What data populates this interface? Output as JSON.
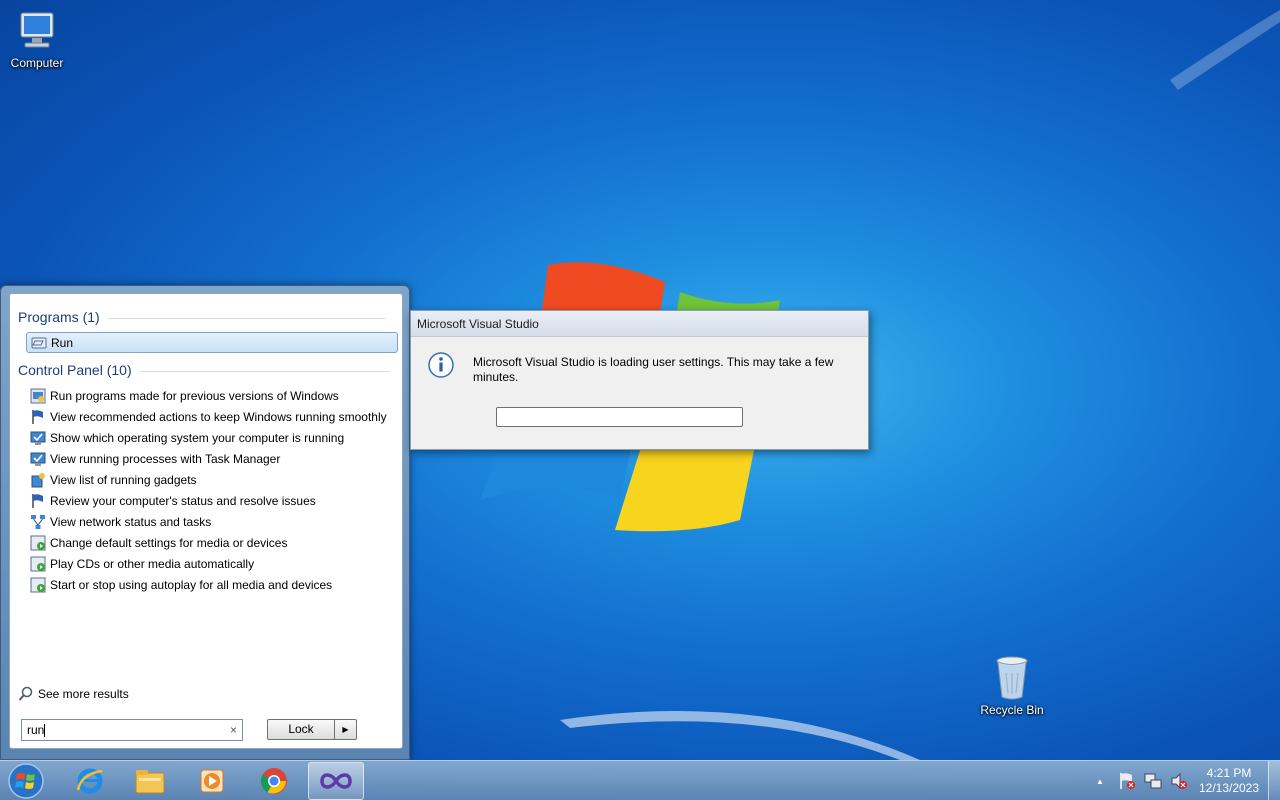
{
  "desktop": {
    "icons": [
      {
        "label": "Computer"
      },
      {
        "label": "Recycle Bin"
      }
    ]
  },
  "start_menu": {
    "programs_heading": "Programs (1)",
    "programs": [
      {
        "label": "Run",
        "icon": "run-icon"
      }
    ],
    "control_panel_heading": "Control Panel (10)",
    "control_panel": [
      {
        "label": "Run programs made for previous versions of Windows",
        "icon": "compat-icon"
      },
      {
        "label": "View recommended actions to keep Windows running smoothly",
        "icon": "flag-icon"
      },
      {
        "label": "Show which operating system your computer is running",
        "icon": "system-icon"
      },
      {
        "label": "View running processes with Task Manager",
        "icon": "system-icon"
      },
      {
        "label": "View list of running gadgets",
        "icon": "gadget-icon"
      },
      {
        "label": "Review your computer's status and resolve issues",
        "icon": "flag-icon"
      },
      {
        "label": "View network status and tasks",
        "icon": "network-icon"
      },
      {
        "label": "Change default settings for media or devices",
        "icon": "autoplay-icon"
      },
      {
        "label": "Play CDs or other media automatically",
        "icon": "autoplay-icon"
      },
      {
        "label": "Start or stop using autoplay for all media and devices",
        "icon": "autoplay-icon"
      }
    ],
    "see_more": "See more results",
    "search_value": "run",
    "search_clear": "×",
    "lock_label": "Lock",
    "lock_arrow": "▶"
  },
  "dialog": {
    "title": "Microsoft Visual Studio",
    "message": "Microsoft Visual Studio is loading user settings. This may take a few minutes.",
    "progress": 0
  },
  "taskbar": {
    "clock_time": "4:21 PM",
    "clock_date": "12/13/2023",
    "tray_arrow": "▲"
  },
  "colors": {
    "desktop_blue": "#136fcf",
    "heading_blue": "#1e3e7a",
    "selection_border": "#7da2ce"
  }
}
